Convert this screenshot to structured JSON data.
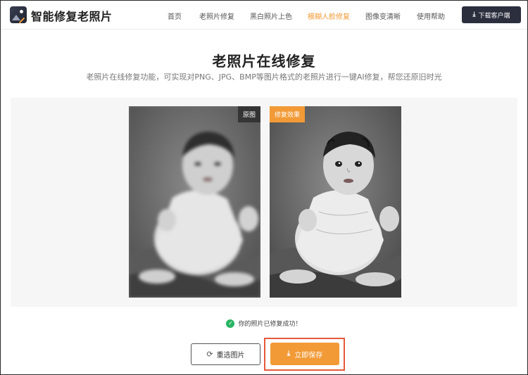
{
  "header": {
    "logo_text": "智能修复老照片",
    "nav": [
      {
        "label": "首页",
        "active": false
      },
      {
        "label": "老照片修复",
        "active": false
      },
      {
        "label": "黑白照片上色",
        "active": false
      },
      {
        "label": "模糊人脸修复",
        "active": true
      },
      {
        "label": "图像变清晰",
        "active": false
      },
      {
        "label": "使用帮助",
        "active": false
      }
    ],
    "download_label": "下载客户端"
  },
  "main": {
    "title": "老照片在线修复",
    "subtitle": "老照片在线修复功能，可实现对PNG、JPG、BMP等图片格式的老照片进行一键AI修复，帮您还原旧时光"
  },
  "compare": {
    "original_label": "原图",
    "result_label": "修复效果"
  },
  "status": {
    "success_text": "你的照片已修复成功！"
  },
  "actions": {
    "reselect_label": "重选图片",
    "save_label": "立即保存"
  },
  "colors": {
    "accent": "#f29a36",
    "dark_button": "#2b2e3d",
    "success": "#28b463",
    "highlight_border": "#e5593a"
  },
  "icons": {
    "logo": "photo-wand-icon",
    "download": "download-icon",
    "refresh": "refresh-icon",
    "check": "check-circle-icon",
    "save": "download-icon"
  }
}
